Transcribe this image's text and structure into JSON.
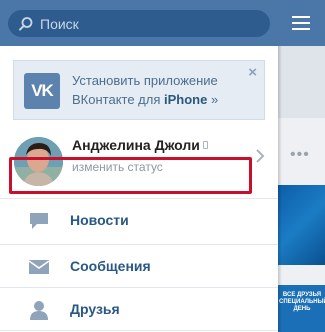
{
  "search": {
    "placeholder": "Поиск"
  },
  "promo": {
    "logo_text": "VK",
    "line1": "Установить приложение",
    "line2_prefix": "ВКонтакте для ",
    "line2_strong": "iPhone",
    "line2_suffix": " »",
    "close": "×"
  },
  "profile": {
    "name": "Анджелина Джоли",
    "status": "изменить статус"
  },
  "nav": {
    "items": [
      {
        "label": "Новости",
        "icon": "speech-bubble-icon"
      },
      {
        "label": "Сообщения",
        "icon": "envelope-icon"
      },
      {
        "label": "Друзья",
        "icon": "person-icon"
      }
    ]
  },
  "background": {
    "dots": "•••",
    "banner_text": "ВСЕ ДРУЗЬЯ СПЕЦИАЛЬНЫЙ ДЕНЬ"
  },
  "colors": {
    "header": "#4a76a8",
    "link": "#2a5885",
    "highlight": "#c8102e"
  }
}
